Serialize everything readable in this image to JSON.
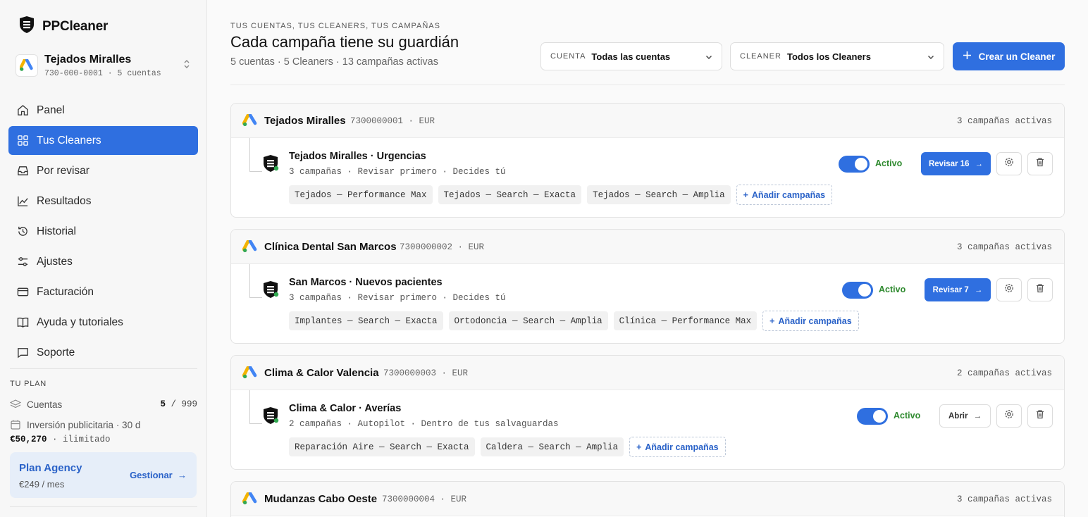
{
  "app": {
    "name": "PPCleaner"
  },
  "account_switcher": {
    "name": "Tejados Miralles",
    "sub": "730-000-0001 · 5 cuentas"
  },
  "nav": [
    {
      "label": "Panel",
      "icon": "home-icon",
      "active": false
    },
    {
      "label": "Tus Cleaners",
      "icon": "grid-icon",
      "active": true
    },
    {
      "label": "Por revisar",
      "icon": "inbox-icon",
      "active": false
    },
    {
      "label": "Resultados",
      "icon": "chart-icon",
      "active": false
    },
    {
      "label": "Historial",
      "icon": "history-icon",
      "active": false
    },
    {
      "label": "Ajustes",
      "icon": "sliders-icon",
      "active": false
    },
    {
      "label": "Facturación",
      "icon": "credit-card-icon",
      "active": false
    },
    {
      "label": "Ayuda y tutoriales",
      "icon": "book-icon",
      "active": false
    },
    {
      "label": "Soporte",
      "icon": "chat-icon",
      "active": false
    }
  ],
  "plan": {
    "heading": "TU PLAN",
    "accounts_label": "Cuentas",
    "accounts_used": "5",
    "accounts_limit": " / 999",
    "spend_label": "Inversión publicitaria · 30 d",
    "spend_value": "€50,270",
    "spend_limit": " · ilimitado",
    "name": "Plan Agency",
    "price": "€249 / mes",
    "manage_label": "Gestionar"
  },
  "header": {
    "eyebrow": "TUS CUENTAS, TUS CLEANERS, TUS CAMPAÑAS",
    "title": "Cada campaña tiene su guardián",
    "subtitle": "5 cuentas · 5 Cleaners · 13 campañas activas"
  },
  "filters": {
    "account_label": "CUENTA",
    "account_value": "Todas las cuentas",
    "cleaner_label": "CLEANER",
    "cleaner_value": "Todos los Cleaners"
  },
  "create_button": "Crear un Cleaner",
  "accounts": [
    {
      "name": "Tejados Miralles",
      "meta": "7300000001 · EUR",
      "count": "3 campañas activas",
      "cleaner": {
        "name": "Tejados Miralles · Urgencias",
        "meta": "3 campañas · Revisar primero · Decides tú",
        "status": "Activo",
        "action": "Revisar 16",
        "action_type": "review",
        "campaigns": [
          "Tejados — Performance Max",
          "Tejados — Search — Exacta",
          "Tejados — Search — Amplia"
        ],
        "add_label": "Añadir campañas"
      }
    },
    {
      "name": "Clínica Dental San Marcos",
      "meta": "7300000002 · EUR",
      "count": "3 campañas activas",
      "cleaner": {
        "name": "San Marcos · Nuevos pacientes",
        "meta": "3 campañas · Revisar primero · Decides tú",
        "status": "Activo",
        "action": "Revisar 7",
        "action_type": "review",
        "campaigns": [
          "Implantes — Search — Exacta",
          "Ortodoncia — Search — Amplia",
          "Clínica — Performance Max"
        ],
        "add_label": "Añadir campañas"
      }
    },
    {
      "name": "Clima & Calor Valencia",
      "meta": "7300000003 · EUR",
      "count": "2 campañas activas",
      "cleaner": {
        "name": "Clima & Calor · Averías",
        "meta": "2 campañas · Autopilot · Dentro de tus salvaguardas",
        "status": "Activo",
        "action": "Abrir",
        "action_type": "open",
        "campaigns": [
          "Reparación Aire — Search — Exacta",
          "Caldera — Search — Amplia"
        ],
        "add_label": "Añadir campañas"
      }
    },
    {
      "name": "Mudanzas Cabo Oeste",
      "meta": "7300000004 · EUR",
      "count": "3 campañas activas"
    }
  ],
  "colors": {
    "accent": "#2f6fe0",
    "active_green": "#2f8a2f",
    "plan_bg": "#e6eef9"
  }
}
